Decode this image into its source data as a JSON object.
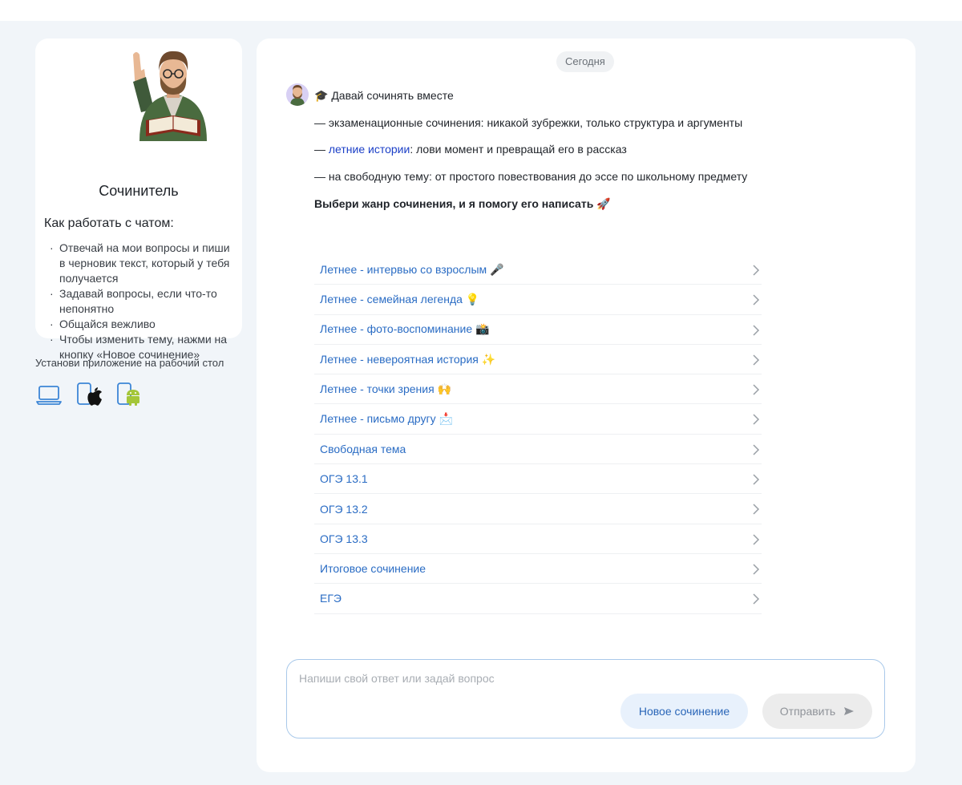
{
  "sidebar": {
    "bot_name": "Сочинитель",
    "howto_title": "Как работать с чатом:",
    "howto_items": [
      "Отвечай на мои вопросы и пиши в черновик текст, который у тебя получается",
      "Задавай вопросы, если что-то непонятно",
      "Общайся вежливо",
      "Чтобы изменить тему, нажми на кнопку «Новое сочинение»"
    ],
    "install_label": "Установи приложение на рабочий стол",
    "install_icons": [
      "laptop-icon",
      "apple-phone-icon",
      "android-phone-icon"
    ]
  },
  "chat": {
    "date_label": "Сегодня",
    "message": {
      "title": "🎓 Давай сочинять вместе",
      "line1": "— экзаменационные сочинения: никакой зубрежки, только структура и аргументы",
      "line2_prefix": "— ",
      "line2_link": "летние истории",
      "line2_suffix": ": лови момент и превращай его в рассказ",
      "line3": "— на свободную тему: от простого повествования до эссе по школьному предмету",
      "prompt": "Выбери жанр сочинения, и я помогу его написать 🚀"
    },
    "options": [
      "Летнее - интервью со взрослым 🎤",
      "Летнее - семейная легенда 💡",
      "Летнее - фото-воспоминание 📸",
      "Летнее - невероятная история ✨",
      "Летнее - точки зрения 🙌",
      "Летнее - письмо другу 📩",
      "Свободная тема",
      "ОГЭ 13.1",
      "ОГЭ 13.2",
      "ОГЭ 13.3",
      "Итоговое сочинение",
      "ЕГЭ"
    ]
  },
  "composer": {
    "placeholder": "Напиши свой ответ или задай вопрос",
    "value": "",
    "new_essay_label": "Новое сочинение",
    "send_label": "Отправить"
  },
  "colors": {
    "page_bg": "#f1f5f9",
    "link": "#2a6cc4",
    "input_border": "#a9c9ea",
    "new_button_bg": "#e8f1fc",
    "send_button_bg": "#ececec"
  }
}
